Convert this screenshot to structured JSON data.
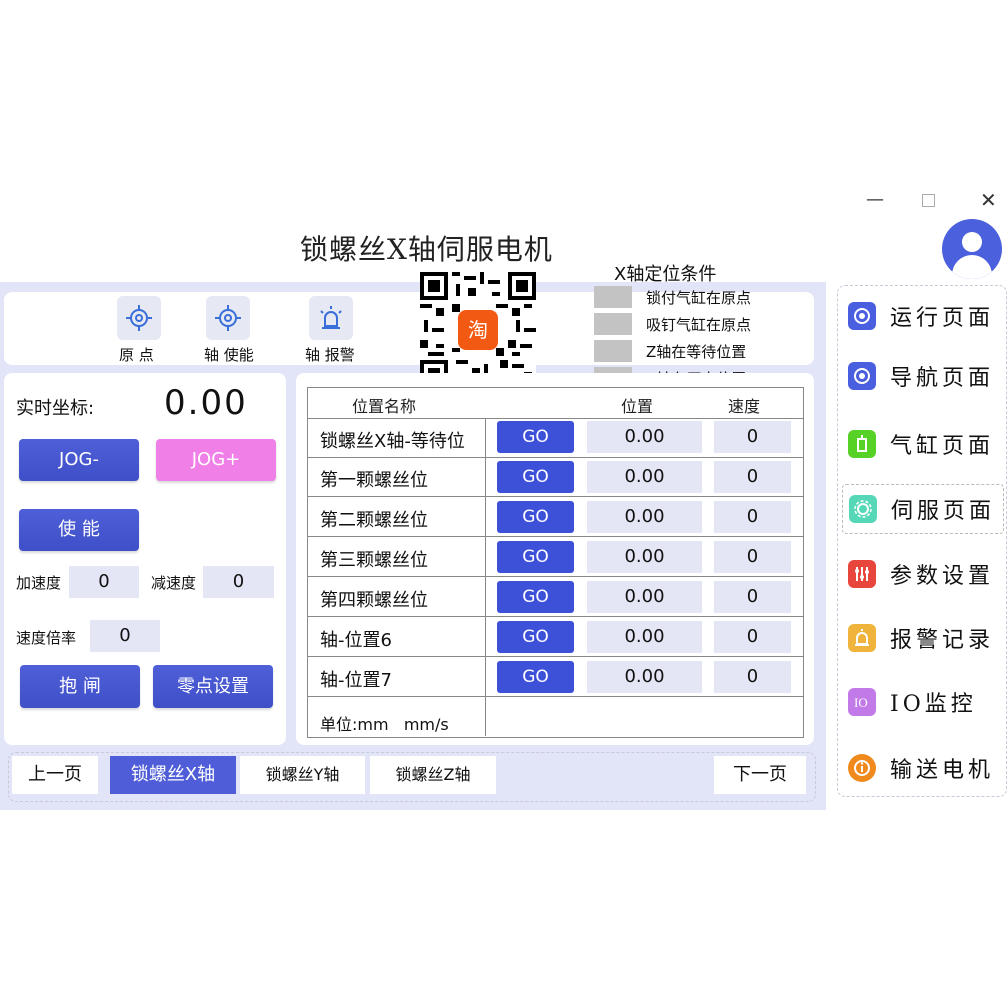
{
  "window": {
    "minimize": "—",
    "close": "✕"
  },
  "app_title": "锁螺丝X轴伺服电机",
  "toolbar": [
    {
      "label": "原 点",
      "icon": "crosshair-icon"
    },
    {
      "label": "轴 使能",
      "icon": "crosshair-icon"
    },
    {
      "label": "轴 报警",
      "icon": "alarm-light-icon"
    }
  ],
  "qr": {
    "badge": "淘"
  },
  "conditions": {
    "title": "X轴定位条件",
    "items": [
      "锁付气缸在原点",
      "吸钉气缸在原点",
      "Z轴在等待位置",
      "Z轴在原点位置"
    ]
  },
  "left": {
    "coord_label": "实时坐标:",
    "coord_value": "0.00",
    "jog_minus": "JOG-",
    "jog_plus": "JOG+",
    "enable": "使 能",
    "accel_label": "加速度",
    "accel_value": "0",
    "decel_label": "减速度",
    "decel_value": "0",
    "rate_label": "速度倍率",
    "rate_value": "0",
    "brake": "抱 闸",
    "zero_set": "零点设置"
  },
  "table": {
    "headers": [
      "位置名称",
      "位置",
      "速度"
    ],
    "go_label": "GO",
    "rows": [
      {
        "name": "锁螺丝X轴-等待位",
        "pos": "0.00",
        "speed": "0"
      },
      {
        "name": "第一颗螺丝位",
        "pos": "0.00",
        "speed": "0"
      },
      {
        "name": "第二颗螺丝位",
        "pos": "0.00",
        "speed": "0"
      },
      {
        "name": "第三颗螺丝位",
        "pos": "0.00",
        "speed": "0"
      },
      {
        "name": "第四颗螺丝位",
        "pos": "0.00",
        "speed": "0"
      },
      {
        "name": " 轴-位置6",
        "pos": "0.00",
        "speed": "0"
      },
      {
        "name": " 轴-位置7",
        "pos": "0.00",
        "speed": "0"
      }
    ],
    "unit": "单位:mm   mm/s"
  },
  "tabs": {
    "prev": "上一页",
    "items": [
      "锁螺丝X轴",
      "锁螺丝Y轴",
      "锁螺丝Z轴"
    ],
    "active": 0,
    "next": "下一页"
  },
  "nav": [
    {
      "label": "运行页面",
      "icon": "run-icon",
      "color": "#4a5ee0"
    },
    {
      "label": "导航页面",
      "icon": "navigation-icon",
      "color": "#4a5ee0"
    },
    {
      "label": "气缸页面",
      "icon": "cylinder-icon",
      "color": "#56d126"
    },
    {
      "label": "伺服页面",
      "icon": "servo-gear-icon",
      "color": "#56d8b8"
    },
    {
      "label": "参数设置",
      "icon": "parameters-icon",
      "color": "#e8453c"
    },
    {
      "label": "报警记录",
      "icon": "alarm-record-icon",
      "color": "#f0b43c"
    },
    {
      "label": "IO监控",
      "icon": "io-monitor-icon",
      "color": "#c27ae8"
    },
    {
      "label": "输送电机",
      "icon": "conveyor-motor-icon",
      "color": "#f08a1c"
    }
  ],
  "nav_active": 3,
  "colors": {
    "accent": "#3d50d8",
    "background": "#e2e4f8",
    "pink": "#f080e8"
  }
}
